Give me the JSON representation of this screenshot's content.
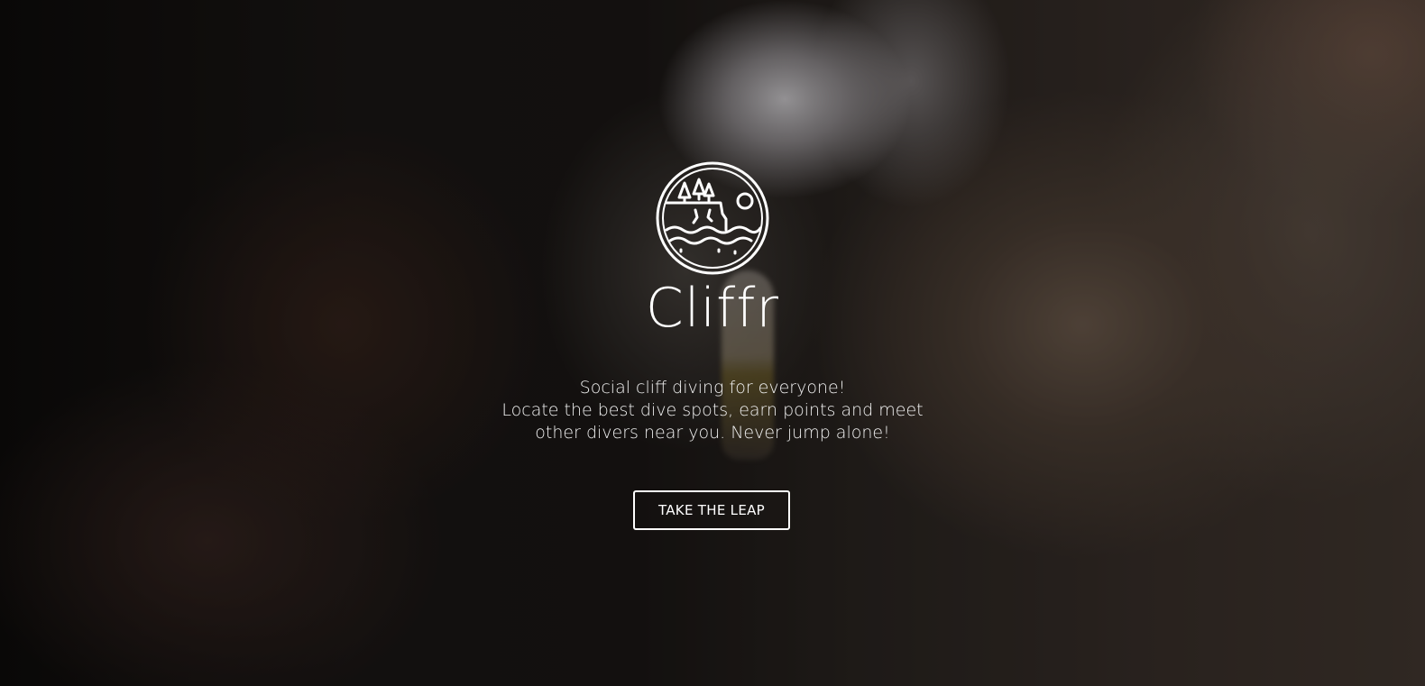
{
  "hero": {
    "app_name": "Cliffr",
    "logo_icon": "cliff-diving-logo-icon",
    "tagline_lines": [
      "Social cliff diving for everyone!",
      "Locate the best dive spots, earn points and meet",
      "other divers near you. Never jump alone!"
    ],
    "cta_label": "TAKE THE LEAP"
  },
  "colors": {
    "text": "#ffffff",
    "button_border": "#ffffff",
    "water_accent": "#2a9696"
  }
}
